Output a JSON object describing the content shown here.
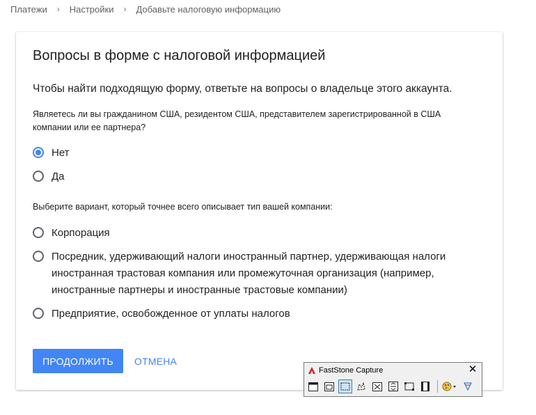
{
  "breadcrumb": {
    "items": [
      "Платежи",
      "Настройки",
      "Добавьте налоговую информацию"
    ],
    "separator": "›"
  },
  "card": {
    "title": "Вопросы в форме с налоговой информацией",
    "intro": "Чтобы найти подходящую форму, ответьте на вопросы о владельце этого аккаунта.",
    "question1": {
      "text": "Являетесь ли вы гражданином США, резидентом США, представителем зарегистрированной в США компании или ее партнера?",
      "options": [
        {
          "label": "Нет",
          "checked": true
        },
        {
          "label": "Да",
          "checked": false
        }
      ]
    },
    "question2": {
      "text": "Выберите вариант, который точнее всего описывает тип вашей компании:",
      "options": [
        {
          "label": "Корпорация",
          "checked": false
        },
        {
          "label": "Посредник, удерживающий налоги иностранный партнер, удерживающая налоги иностранная трастовая компания или промежуточная организация (например, иностранные партнеры и иностранные трастовые компании)",
          "checked": false
        },
        {
          "label": "Предприятие, освобожденное от уплаты налогов",
          "checked": false
        }
      ]
    },
    "actions": {
      "continue_label": "ПРОДОЛЖИТЬ",
      "cancel_label": "ОТМЕНА"
    }
  },
  "faststone": {
    "title": "FastStone Capture",
    "close_label": "✕",
    "tools": [
      "window-capture-icon",
      "object-capture-icon",
      "rectangle-capture-icon",
      "freehand-capture-icon",
      "fullscreen-capture-icon",
      "scrolling-capture-icon",
      "fixed-region-capture-icon",
      "video-capture-icon",
      "output-menu-icon",
      "settings-menu-icon"
    ]
  },
  "colors": {
    "accent": "#4285f4",
    "text": "#212121",
    "muted": "#616161"
  }
}
